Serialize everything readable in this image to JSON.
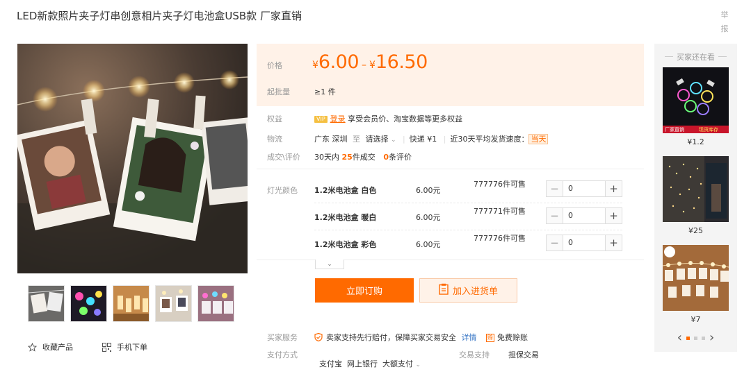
{
  "title": "LED新款照片夹子灯串创意相片夹子灯电池盒USB款 厂家直销",
  "report_link": "举报",
  "gallery": {
    "favorite_label": "收藏产品",
    "mobile_order_label": "手机下单",
    "thumb_count": 5
  },
  "price": {
    "label": "价格",
    "currency": "¥",
    "low": "6.00",
    "high": "16.50",
    "separator": "–"
  },
  "moq": {
    "label": "起批量",
    "value": "≥1 件"
  },
  "benefits": {
    "label": "权益",
    "vip_badge": "VIP",
    "login_link": "登录",
    "text": "享受会员价、淘宝数据等更多权益"
  },
  "logistics": {
    "label": "物流",
    "origin": "广东 深圳",
    "to": "至",
    "select": "请选择",
    "express": "快递 ¥1",
    "speed_label": "近30天平均发货速度：",
    "speed_value": "当天"
  },
  "reviews": {
    "label": "成交\\评价",
    "prefix": "30天内",
    "sold_count": "25",
    "sold_suffix": "件成交",
    "review_count": "0",
    "review_suffix": "条评价"
  },
  "variants": {
    "label": "灯光颜色",
    "rows": [
      {
        "name": "1.2米电池盒 白色",
        "price": "6.00元",
        "stock": "777776件可售",
        "qty": "0"
      },
      {
        "name": "1.2米电池盒 暖白",
        "price": "6.00元",
        "stock": "777771件可售",
        "qty": "0"
      },
      {
        "name": "1.2米电池盒 彩色",
        "price": "6.00元",
        "stock": "777776件可售",
        "qty": "0"
      }
    ]
  },
  "actions": {
    "order_now": "立即订购",
    "add_to_cart": "加入进货单"
  },
  "services": {
    "label": "买家服务",
    "guarantee": "卖家支持先行赔付，保障买家交易安全",
    "details": "详情",
    "free_badge": "赊",
    "free_text": "免费赊账"
  },
  "payment": {
    "label": "支付方式",
    "methods": "支付宝  网上银行  大额支付",
    "trade_label": "交易支持",
    "trade_value": "担保交易"
  },
  "sidebar": {
    "title": "买家还在看",
    "items": [
      {
        "price": "¥1.2",
        "banner_left": "厂家直销",
        "banner_right": "现货库存"
      },
      {
        "price": "¥25"
      },
      {
        "price": "¥7"
      }
    ],
    "prev": "‹",
    "next": "›"
  },
  "colors": {
    "accent": "#ff6a00",
    "price_bg": "#fff2e8",
    "link_blue": "#3b78c6"
  }
}
